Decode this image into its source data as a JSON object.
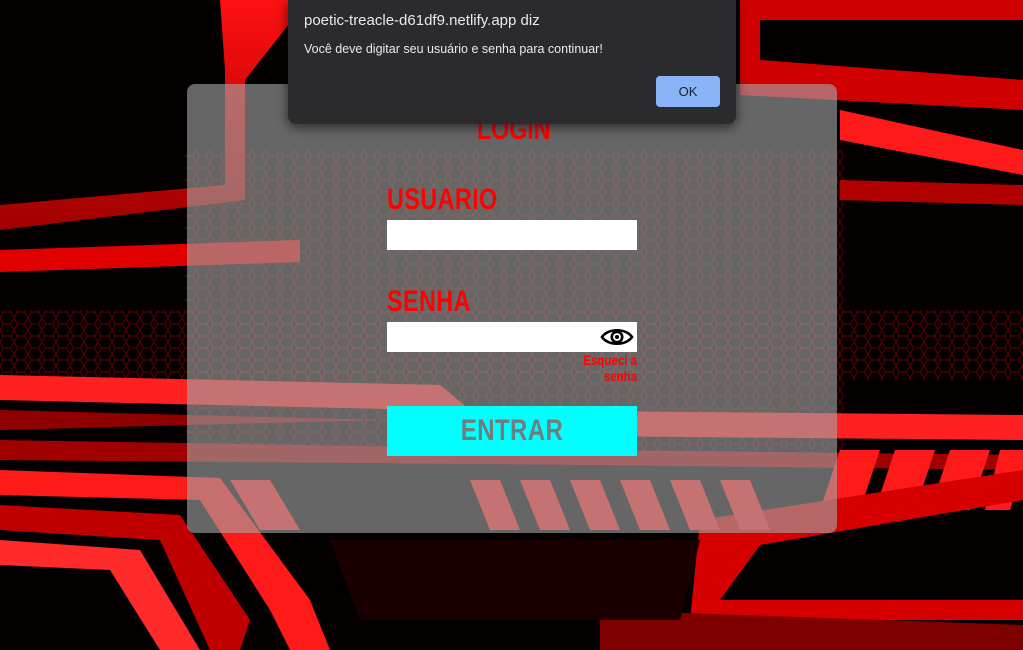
{
  "alert": {
    "title": "poetic-treacle-d61df9.netlify.app diz",
    "message": "Você deve digitar seu usuário e senha para continuar!",
    "ok_label": "OK"
  },
  "login": {
    "title": "LOGIN",
    "user_label": "USUARIO",
    "user_value": "",
    "password_label": "SENHA",
    "password_value": "",
    "show_password_icon": "eye-icon",
    "forgot_label": "Esqueci a senha",
    "submit_label": "ENTRAR"
  },
  "colors": {
    "accent_red": "#ff0000",
    "button_cyan": "#00ffff",
    "dialog_bg": "#2b2b2e",
    "dialog_button": "#8ab4f8"
  }
}
